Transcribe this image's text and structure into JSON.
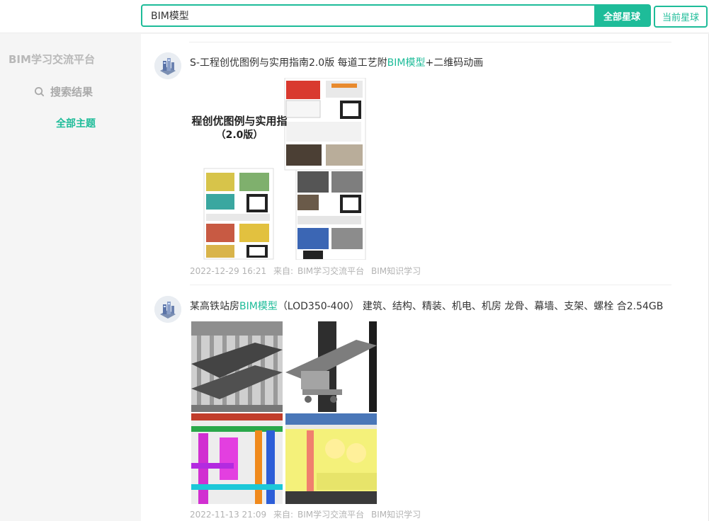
{
  "search": {
    "value": "BIM模型",
    "all_label": "全部星球",
    "current_label": "当前星球"
  },
  "sidebar": {
    "title": "BIM学习交流平台",
    "search_results": "搜索结果",
    "all_topics": "全部主题"
  },
  "posts": [
    {
      "title_pre": "S-工程创优图例与实用指南2.0版 每道工艺附",
      "title_hl": "BIM模型",
      "title_post": "+二维码动画",
      "image_caption_line1": "程创优图例与实用指",
      "image_caption_line2": "（2.0版）",
      "date": "2022-12-29 16:21",
      "from_label": "来自:",
      "source": "BIM学习交流平台",
      "tag": "BIM知识学习"
    },
    {
      "title_pre": "某高铁站房",
      "title_hl": "BIM模型",
      "title_post": "（LOD350-400） 建筑、结构、精装、机电、机房 龙骨、幕墙、支架、螺栓 合2.54GB",
      "date": "2022-11-13 21:09",
      "from_label": "来自:",
      "source": "BIM学习交流平台",
      "tag": "BIM知识学习"
    }
  ],
  "colors": {
    "accent": "#1ebc99",
    "meta": "#b3b3b3"
  }
}
